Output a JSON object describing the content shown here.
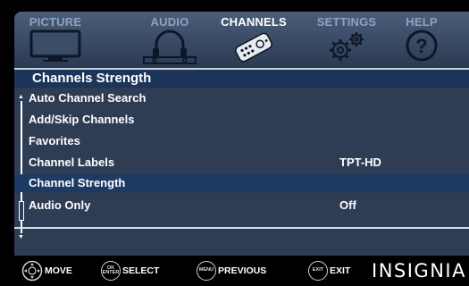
{
  "tabs": [
    {
      "label": "PICTURE",
      "icon": "tv-icon",
      "active": false
    },
    {
      "label": "AUDIO",
      "icon": "headphones-icon",
      "active": false
    },
    {
      "label": "CHANNELS",
      "icon": "remote-icon",
      "active": true
    },
    {
      "label": "SETTINGS",
      "icon": "gears-icon",
      "active": false
    },
    {
      "label": "HELP",
      "icon": "help-icon",
      "active": false
    }
  ],
  "panel": {
    "title": "Channels Strength",
    "items": [
      {
        "label": "Auto Channel Search",
        "value": ""
      },
      {
        "label": "Add/Skip Channels",
        "value": ""
      },
      {
        "label": "Favorites",
        "value": ""
      },
      {
        "label": "Channel Labels",
        "value": "TPT-HD"
      },
      {
        "label": "Channel Strength",
        "value": "",
        "selected": true
      },
      {
        "label": "Audio Only",
        "value": "Off"
      }
    ]
  },
  "bottom": {
    "hints": [
      {
        "icon_text": "",
        "label": "MOVE"
      },
      {
        "icon_text": "OK ENTER",
        "label": "SELECT"
      },
      {
        "icon_text": "MENU",
        "label": "PREVIOUS"
      },
      {
        "icon_text": "EXIT",
        "label": "EXIT"
      }
    ],
    "brand": "INSIGNIA"
  },
  "colors": {
    "tab_active": "#ffffff",
    "tab_inactive": "#8ea3c1",
    "panel_bg": "#2e3c54",
    "selected_bg": "#1d3a63"
  }
}
